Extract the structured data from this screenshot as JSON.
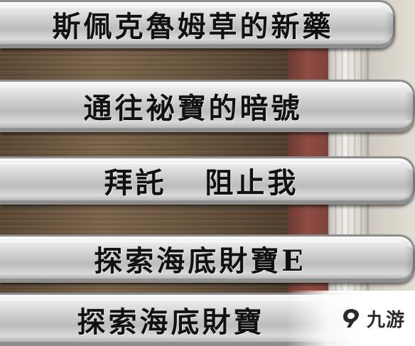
{
  "menu": {
    "items": [
      {
        "label": "斯佩克魯姆草的新藥"
      },
      {
        "label": "通往袐寶的暗號"
      },
      {
        "label": "拜託   阻止我"
      },
      {
        "label": "探索海底財寶E"
      },
      {
        "label": "探索海底財寶"
      }
    ]
  },
  "watermark": {
    "text": "九游",
    "icon": "jiuyou-logo-icon"
  }
}
